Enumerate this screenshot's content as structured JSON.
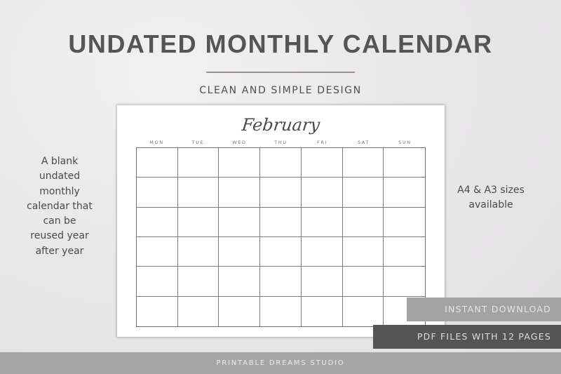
{
  "header": {
    "title": "UNDATED MONTHLY CALENDAR",
    "subtitle": "CLEAN AND SIMPLE DESIGN"
  },
  "side_left": {
    "lines": [
      "A blank",
      "undated",
      "monthly",
      "calendar that",
      "can be",
      "reused year",
      "after year"
    ]
  },
  "side_right": {
    "lines": [
      "A4 & A3 sizes",
      "available"
    ]
  },
  "calendar": {
    "month": "February",
    "weekdays": [
      "MON",
      "TUE",
      "WED",
      "THU",
      "FRI",
      "SAT",
      "SUN"
    ],
    "rows": 6,
    "columns": 7
  },
  "badges": {
    "instant_download": "INSTANT DOWNLOAD",
    "pdf_files": "PDF FILES WITH 12 PAGES"
  },
  "footer": {
    "brand": "PRINTABLE DREAMS STUDIO"
  },
  "colors": {
    "title": "#555555",
    "divider": "#9a938c",
    "badge_light": "#a3a3a3",
    "badge_dark": "#545454",
    "footer": "#a6a6a6"
  }
}
